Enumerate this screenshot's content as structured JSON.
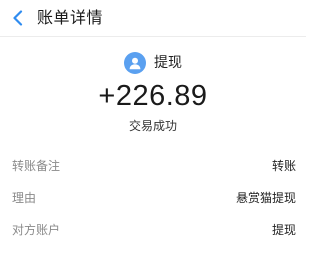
{
  "header": {
    "title": "账单详情",
    "back_icon": "back-arrow-icon"
  },
  "colors": {
    "accent": "#2f8cf0",
    "avatar_bg": "#5aa0f0"
  },
  "payee": {
    "avatar_icon": "user-icon",
    "name": "提现"
  },
  "transaction": {
    "amount": "+226.89",
    "status": "交易成功"
  },
  "details": [
    {
      "label": "转账备注",
      "value": "转账"
    },
    {
      "label": "理由",
      "value": "悬赏猫提现"
    },
    {
      "label": "对方账户",
      "value": "提现"
    }
  ]
}
